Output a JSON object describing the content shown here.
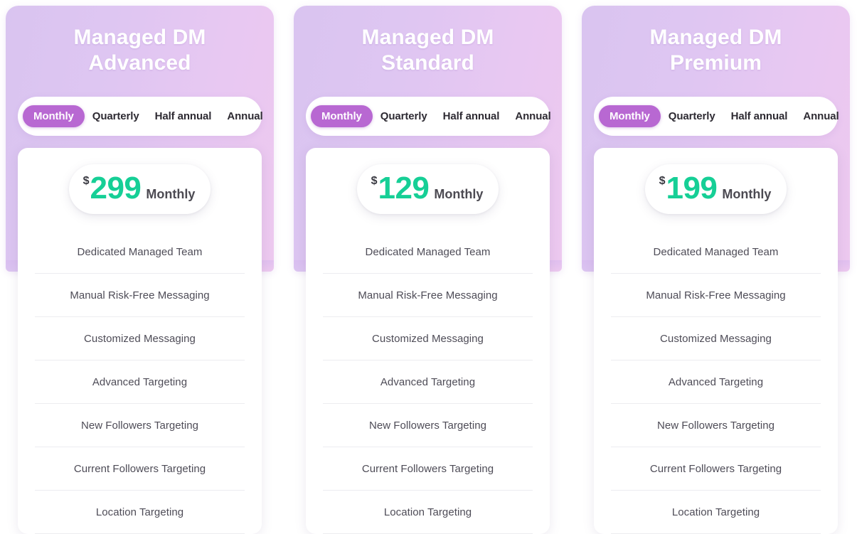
{
  "theme": {
    "page_background": "#ffffff",
    "banner_gradient_start": "#d9c4f0",
    "banner_gradient_end": "#edc9ef",
    "active_pill_color": "#b868d2",
    "price_color": "#16cf96",
    "feature_text_color": "#4e4c57",
    "divider_color": "#ececf0"
  },
  "billing_cycles": [
    {
      "label": "Monthly",
      "active": true
    },
    {
      "label": "Quarterly",
      "active": false
    },
    {
      "label": "Half annual",
      "active": false
    },
    {
      "label": "Annual",
      "active": false
    }
  ],
  "plans": [
    {
      "title_line1": "Managed DM",
      "title_line2": "Advanced",
      "currency": "$",
      "amount": "299",
      "period": "Monthly",
      "features": [
        "Dedicated Managed Team",
        "Manual Risk-Free Messaging",
        "Customized Messaging",
        "Advanced Targeting",
        "New Followers Targeting",
        "Current Followers Targeting",
        "Location Targeting"
      ]
    },
    {
      "title_line1": "Managed DM",
      "title_line2": "Standard",
      "currency": "$",
      "amount": "129",
      "period": "Monthly",
      "features": [
        "Dedicated Managed Team",
        "Manual Risk-Free Messaging",
        "Customized Messaging",
        "Advanced Targeting",
        "New Followers Targeting",
        "Current Followers Targeting",
        "Location Targeting"
      ]
    },
    {
      "title_line1": "Managed DM",
      "title_line2": "Premium",
      "currency": "$",
      "amount": "199",
      "period": "Monthly",
      "features": [
        "Dedicated Managed Team",
        "Manual Risk-Free Messaging",
        "Customized Messaging",
        "Advanced Targeting",
        "New Followers Targeting",
        "Current Followers Targeting",
        "Location Targeting"
      ]
    }
  ]
}
